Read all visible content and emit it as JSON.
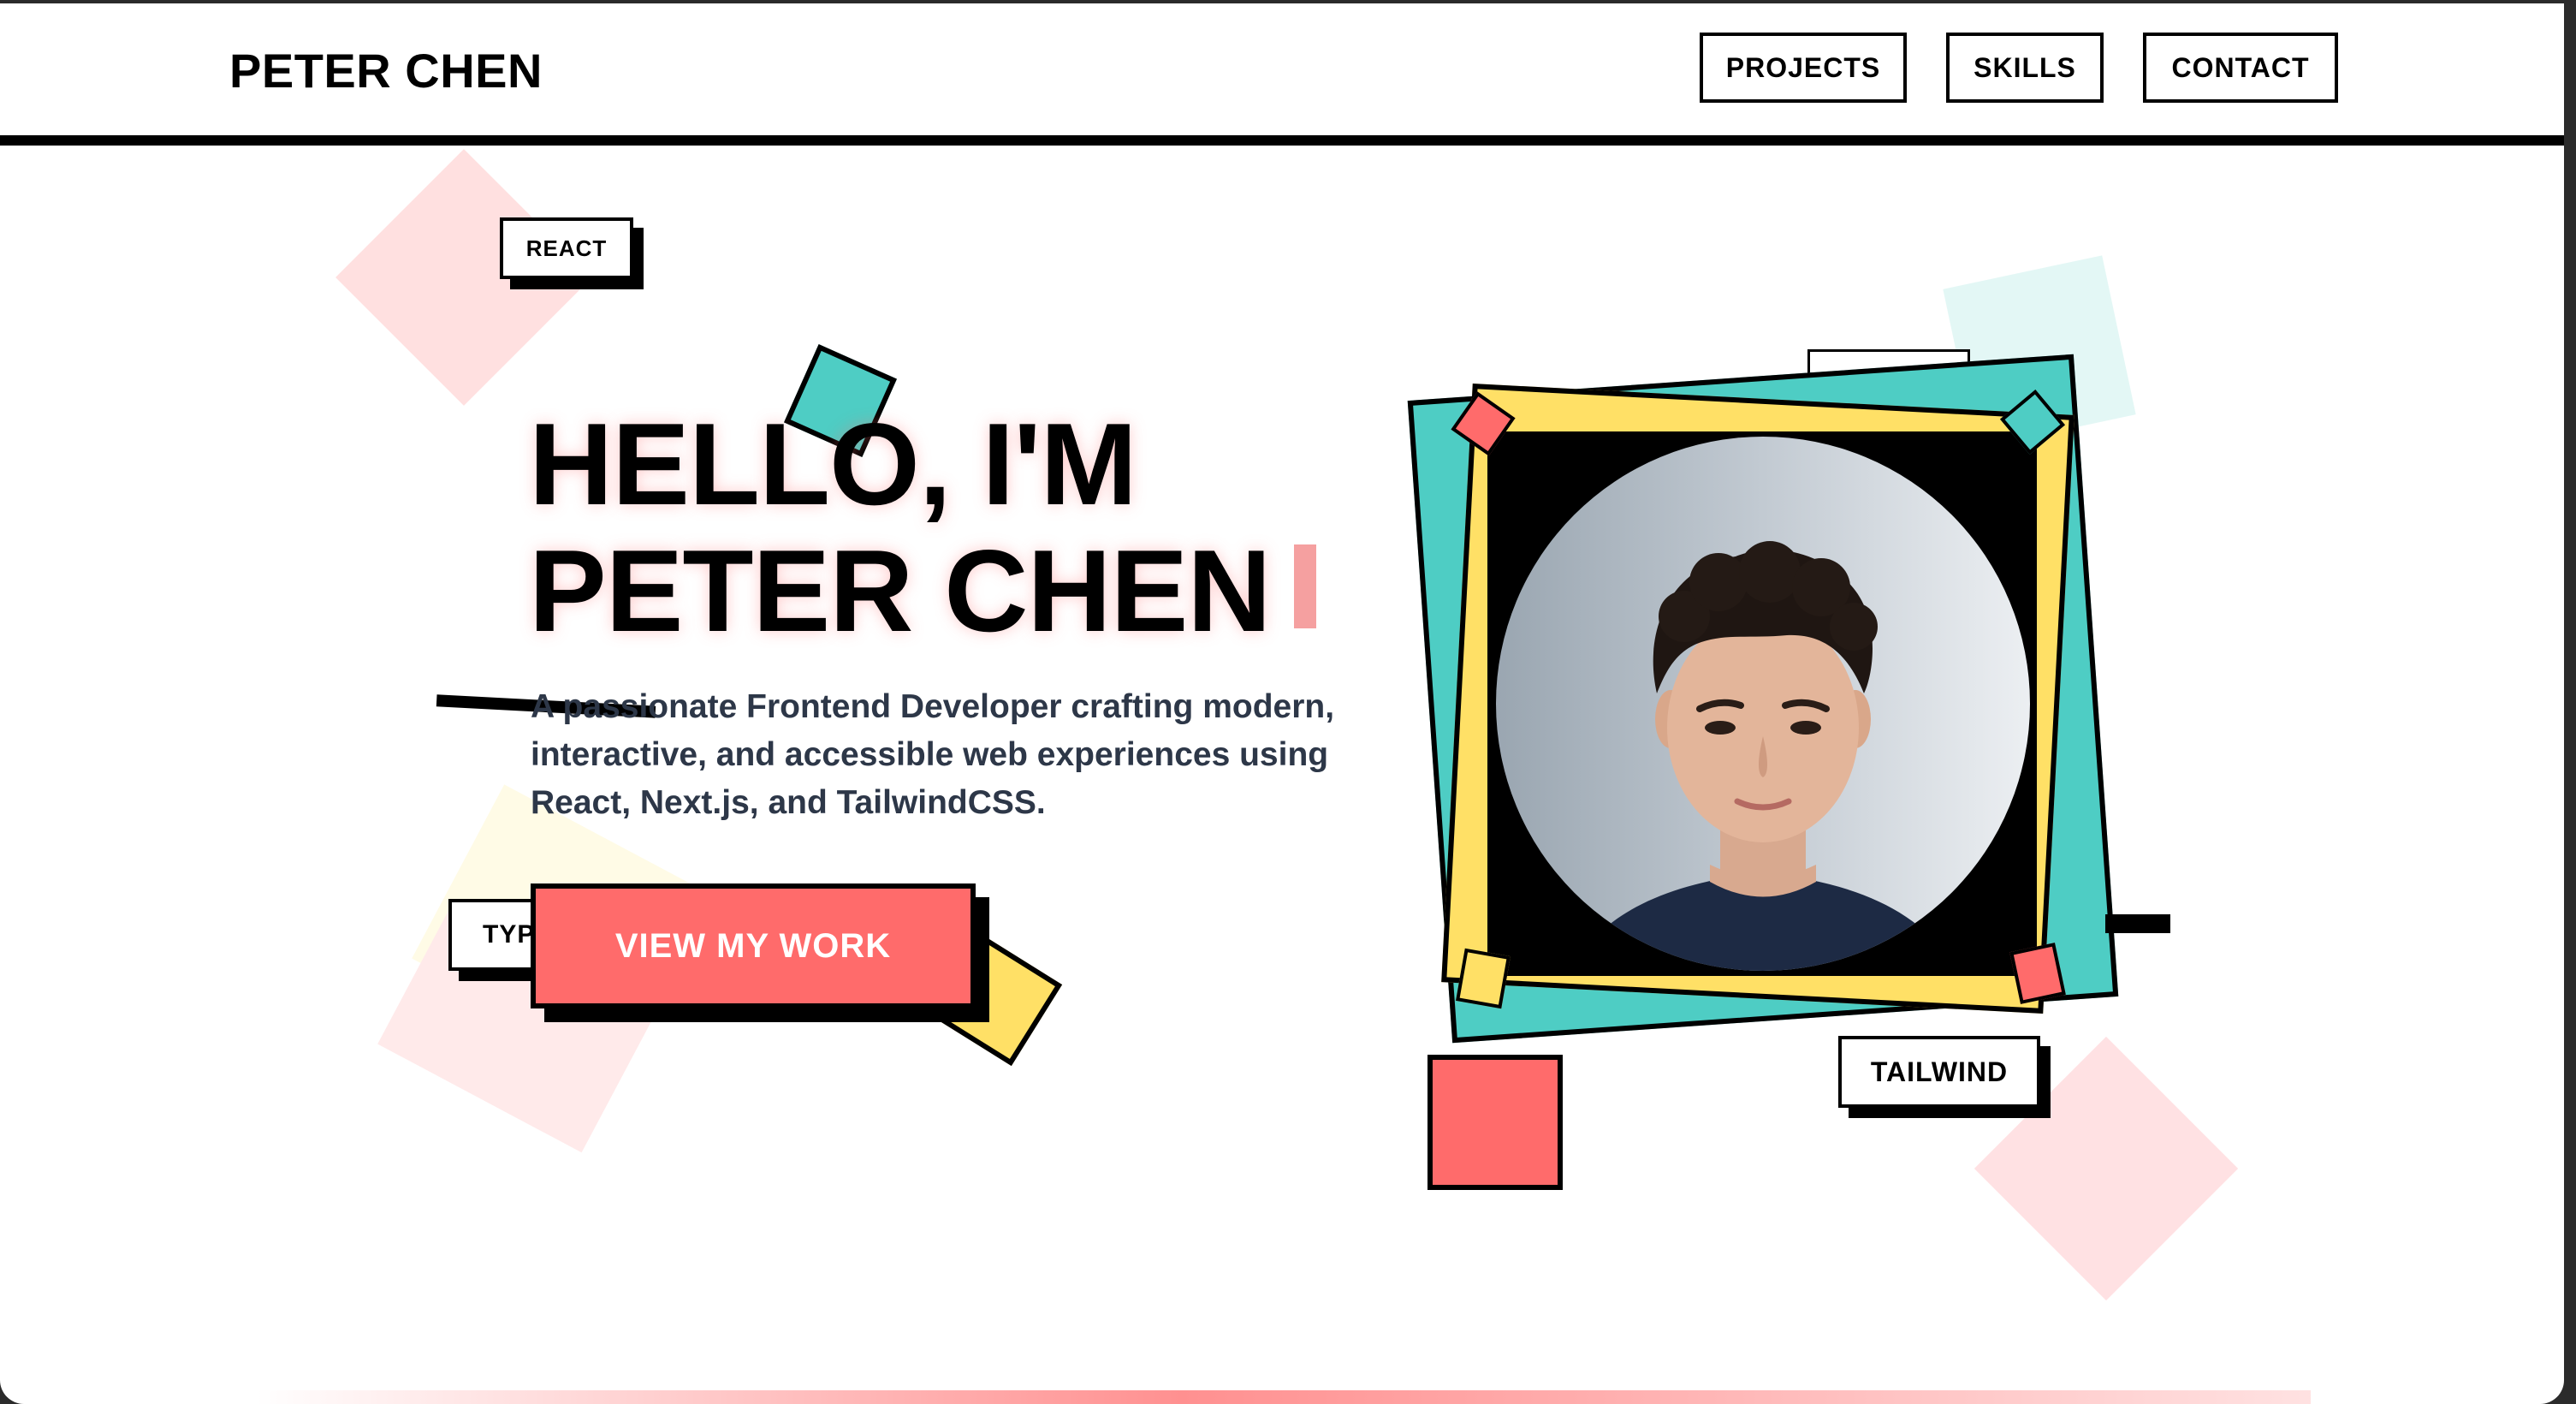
{
  "header": {
    "logo": "PETER CHEN",
    "nav": [
      {
        "label": "PROJECTS"
      },
      {
        "label": "SKILLS"
      },
      {
        "label": "CONTACT"
      }
    ]
  },
  "hero": {
    "heading_line1": "HELLO, I'M",
    "heading_line2": "PETER CHEN",
    "description_lines": [
      "A passionate Frontend Developer crafting modern,",
      "interactive, and accessible web experiences using",
      "React, Next.js, and TailwindCSS."
    ],
    "cta_label": "VIEW MY WORK"
  },
  "tags": {
    "react": "REACT",
    "typescript_partial": "TYP",
    "tailwind": "TAILWIND"
  },
  "colors": {
    "coral": "#ff6b6b",
    "teal": "#4ecdc4",
    "yellow": "#ffe066",
    "black": "#000000",
    "text_gray": "#2d3748"
  }
}
